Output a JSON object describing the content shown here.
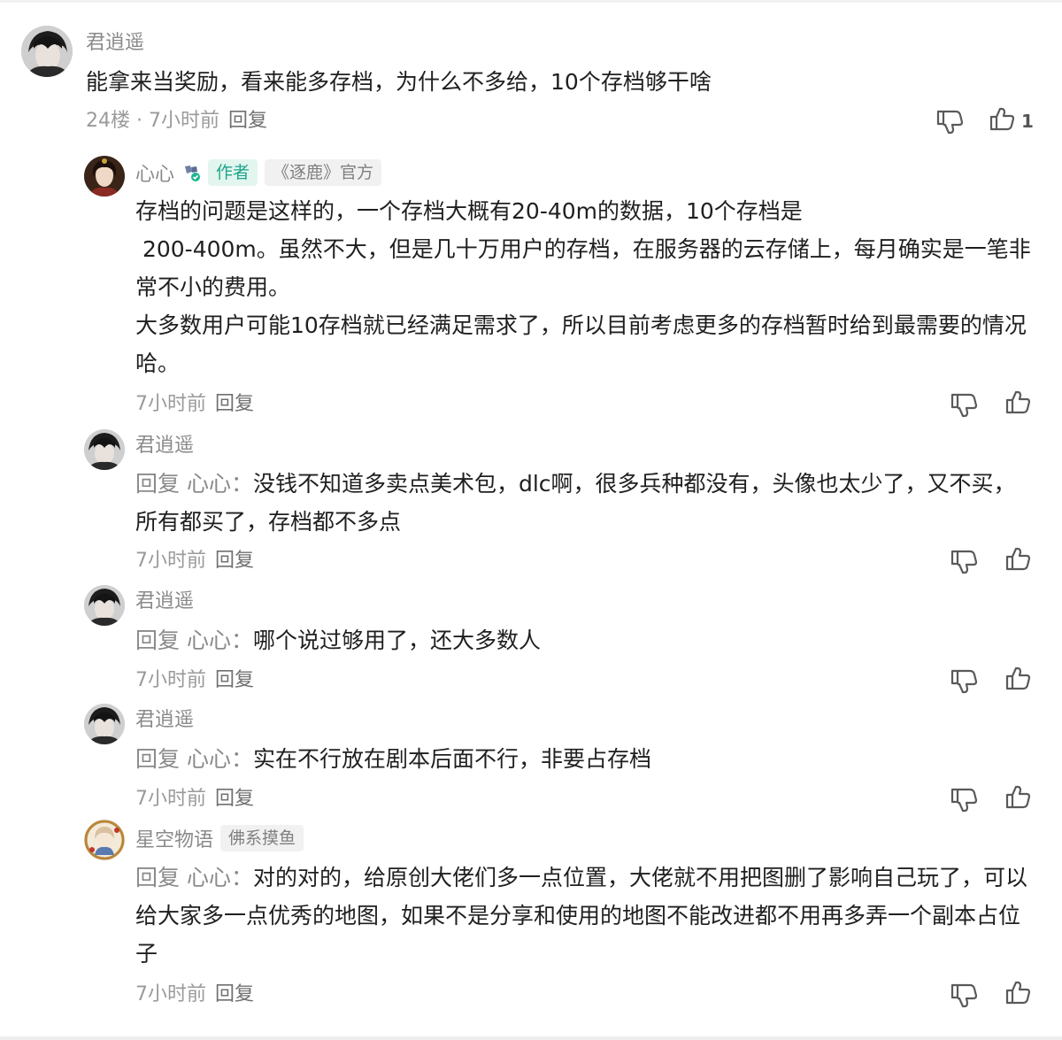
{
  "top_comment": {
    "author": "君逍遥",
    "text": "能拿来当奖励，看来能多存档，为什么不多给，10个存档够干啥",
    "floor_time": "24楼 · 7小时前",
    "reply_label": "回复",
    "like_count": "1"
  },
  "replies": [
    {
      "author": "心心",
      "author_tag": "作者",
      "official_tag": "《逐鹿》官方",
      "text": "存档的问题是这样的，一个存档大概有20-40m的数据，10个存档是\n 200-400m。虽然不大，但是几十万用户的存档，在服务器的云存储上，每月确实是一笔非常不小的费用。\n大多数用户可能10存档就已经满足需求了，所以目前考虑更多的存档暂时给到最需要的情况哈。",
      "time": "7小时前",
      "reply_label": "回复"
    },
    {
      "author": "君逍遥",
      "reply_prefix": "回复",
      "reply_target": "心心：",
      "text": "没钱不知道多卖点美术包，dlc啊，很多兵种都没有，头像也太少了，又不买，所有都买了，存档都不多点",
      "time": "7小时前",
      "reply_label": "回复"
    },
    {
      "author": "君逍遥",
      "reply_prefix": "回复",
      "reply_target": "心心：",
      "text": "哪个说过够用了，还大多数人",
      "time": "7小时前",
      "reply_label": "回复"
    },
    {
      "author": "君逍遥",
      "reply_prefix": "回复",
      "reply_target": "心心：",
      "text": "实在不行放在剧本后面不行，非要占存档",
      "time": "7小时前",
      "reply_label": "回复"
    },
    {
      "author": "星空物语",
      "author_tag": "佛系摸鱼",
      "reply_prefix": "回复",
      "reply_target": "心心：",
      "text": "对的对的，给原创大佬们多一点位置，大佬就不用把图删了影响自己玩了，可以给大家多一点优秀的地图，如果不是分享和使用的地图不能改进都不用再多弄一个副本占位子",
      "time": "7小时前",
      "reply_label": "回复"
    }
  ],
  "icons": {
    "dislike": "thumbs-down-icon",
    "like": "thumbs-up-icon",
    "verified": "verified-check-icon"
  },
  "colors": {
    "author_tag_text": "#1fa58a",
    "author_tag_bg": "#e3f5ef",
    "meta_gray": "#9a9a9a"
  }
}
